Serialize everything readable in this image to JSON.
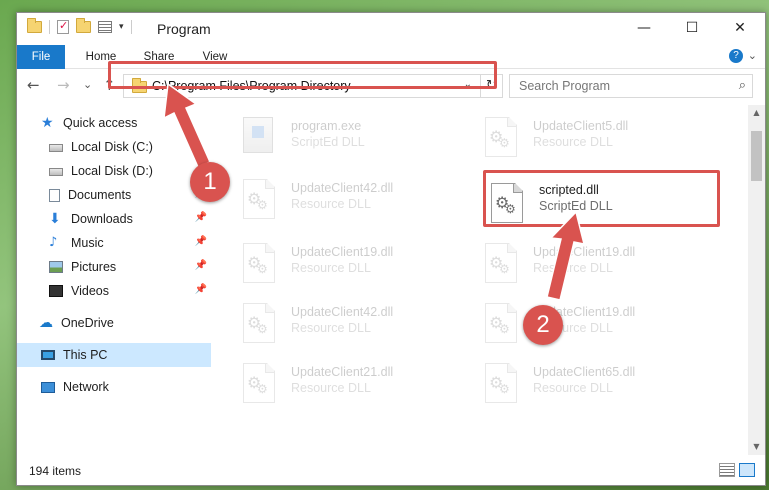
{
  "window": {
    "title": "Program",
    "controls": {
      "minimize": "—",
      "maximize": "☐",
      "close": "✕"
    }
  },
  "ribbon": {
    "tabs": [
      "File",
      "Home",
      "Share",
      "View"
    ],
    "accent": "#1979ca"
  },
  "nav": {
    "back": "←",
    "forward": "→",
    "recent": "⌄",
    "up": "↑",
    "address": "C:\\Program Files\\Program Directory",
    "search_placeholder": "Search Program"
  },
  "sidebar": {
    "items": [
      {
        "label": "Quick access",
        "icon": "star-icon",
        "pinned": false
      },
      {
        "label": "Local Disk (C:)",
        "icon": "drive-icon",
        "pinned": false
      },
      {
        "label": "Local Disk (D:)",
        "icon": "drive-icon",
        "pinned": false
      },
      {
        "label": "Documents",
        "icon": "documents-icon",
        "pinned": true
      },
      {
        "label": "Downloads",
        "icon": "download-icon",
        "pinned": true
      },
      {
        "label": "Music",
        "icon": "music-icon",
        "pinned": true
      },
      {
        "label": "Pictures",
        "icon": "pictures-icon",
        "pinned": true
      },
      {
        "label": "Videos",
        "icon": "videos-icon",
        "pinned": true
      },
      {
        "label": "OneDrive",
        "icon": "cloud-icon",
        "pinned": false
      },
      {
        "label": "This PC",
        "icon": "pc-icon",
        "pinned": false,
        "selected": true
      },
      {
        "label": "Network",
        "icon": "network-icon",
        "pinned": false
      }
    ]
  },
  "files": [
    {
      "name": "program.exe",
      "desc": "ScriptEd DLL",
      "faded": true
    },
    {
      "name": "UpdateClient5.dll",
      "desc": "Resource DLL",
      "faded": true
    },
    {
      "name": "UpdateClient42.dll",
      "desc": "Resource DLL",
      "faded": true
    },
    {
      "name": "scripted.dll",
      "desc": "ScriptEd DLL",
      "faded": false
    },
    {
      "name": "UpdateClient19.dll",
      "desc": "Resource DLL",
      "faded": true
    },
    {
      "name": "UpdateClient19.dll",
      "desc": "Resource DLL",
      "faded": true
    },
    {
      "name": "UpdateClient42.dll",
      "desc": "Resource DLL",
      "faded": true
    },
    {
      "name": "UpdateClient19.dll",
      "desc": "Resource DLL",
      "faded": true
    },
    {
      "name": "UpdateClient21.dll",
      "desc": "Resource DLL",
      "faded": true
    },
    {
      "name": "UpdateClient65.dll",
      "desc": "Resource DLL",
      "faded": true
    }
  ],
  "status": {
    "item_count": "194 items"
  },
  "annotations": {
    "step1": "1",
    "step2": "2",
    "color": "#d9534f"
  }
}
